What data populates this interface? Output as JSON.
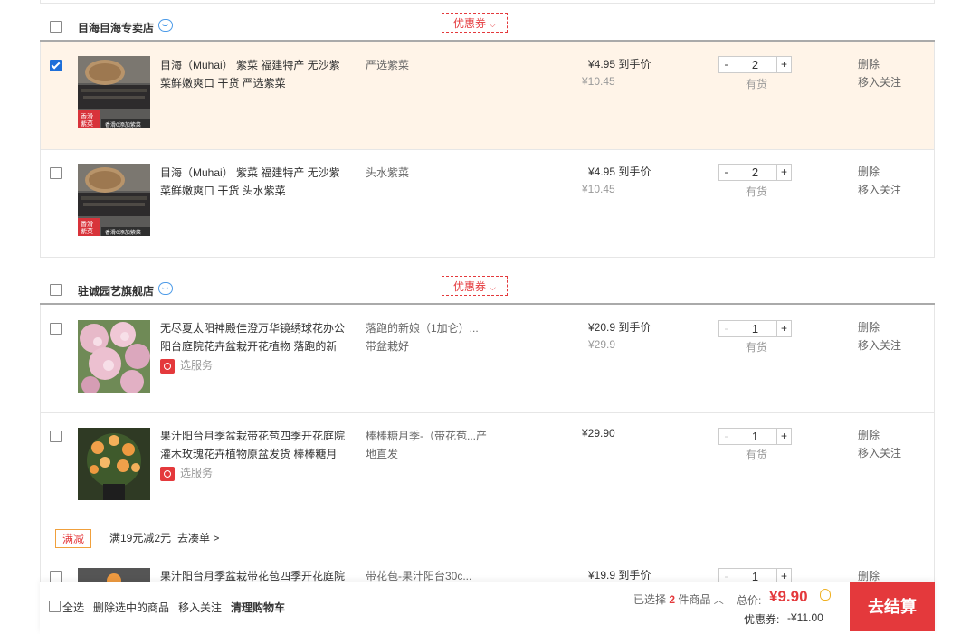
{
  "shops": [
    {
      "name": "目海目海专卖店",
      "coupon": "优惠券",
      "items": [
        {
          "title": "目海（Muhai） 紫菜 福建特产 无沙紫菜鲜嫩爽口 干货 严选紫菜",
          "spec": "严选紫菜",
          "price": "¥4.95 到手价",
          "old_price": "¥10.45",
          "qty": "2",
          "stock": "有货",
          "delete": "删除",
          "follow": "移入关注",
          "checked": true
        },
        {
          "title": "目海（Muhai） 紫菜 福建特产 无沙紫菜鲜嫩爽口 干货 头水紫菜",
          "spec": "头水紫菜",
          "price": "¥4.95 到手价",
          "old_price": "¥10.45",
          "qty": "2",
          "stock": "有货",
          "delete": "删除",
          "follow": "移入关注",
          "checked": false
        }
      ]
    },
    {
      "name": "驻诚园艺旗舰店",
      "coupon": "优惠券",
      "items": [
        {
          "title": "无尽夏太阳神殿佳澄万华镜绣球花办公阳台庭院花卉盆栽开花植物 落跑的新",
          "spec": "落跑的新娘（1加仑）...带盆栽好",
          "price": "¥20.9 到手价",
          "old_price": "¥29.9",
          "service": "选服务",
          "qty": "1",
          "stock": "有货",
          "delete": "删除",
          "follow": "移入关注",
          "checked": false
        },
        {
          "title": "果汁阳台月季盆栽带花苞四季开花庭院灌木玫瑰花卉植物原盆发货 棒棒糖月",
          "spec": "棒棒糖月季-（带花苞...产地直发",
          "price": "¥29.90",
          "service": "选服务",
          "qty": "1",
          "stock": "有货",
          "delete": "删除",
          "follow": "移入关注",
          "checked": false
        }
      ],
      "promo": {
        "tag": "满减",
        "text": "满19元减2元",
        "link": "去凑单 >"
      },
      "partial_item": {
        "title": "果汁阳台月季盆栽带花苞四季开花庭院",
        "spec": "带花苞-果汁阳台30c...",
        "price": "¥19.9 到手价",
        "qty": "1",
        "delete": "删除"
      }
    }
  ],
  "footer": {
    "select_all": "全选",
    "delete_selected": "删除选中的商品",
    "move_follow": "移入关注",
    "clear_cart": "清理购物车",
    "selected_prefix": "已选择",
    "selected_count": "2",
    "selected_suffix": "件商品",
    "total_label": "总价:",
    "total_value": "¥9.90",
    "discount_label": "优惠券:",
    "discount_value": "-¥11.00",
    "checkout": "去结算"
  },
  "colors": {
    "accent": "#e4393c",
    "selected_row_bg": "#fff4e8",
    "checkbox_blue": "#1e6fd9"
  }
}
